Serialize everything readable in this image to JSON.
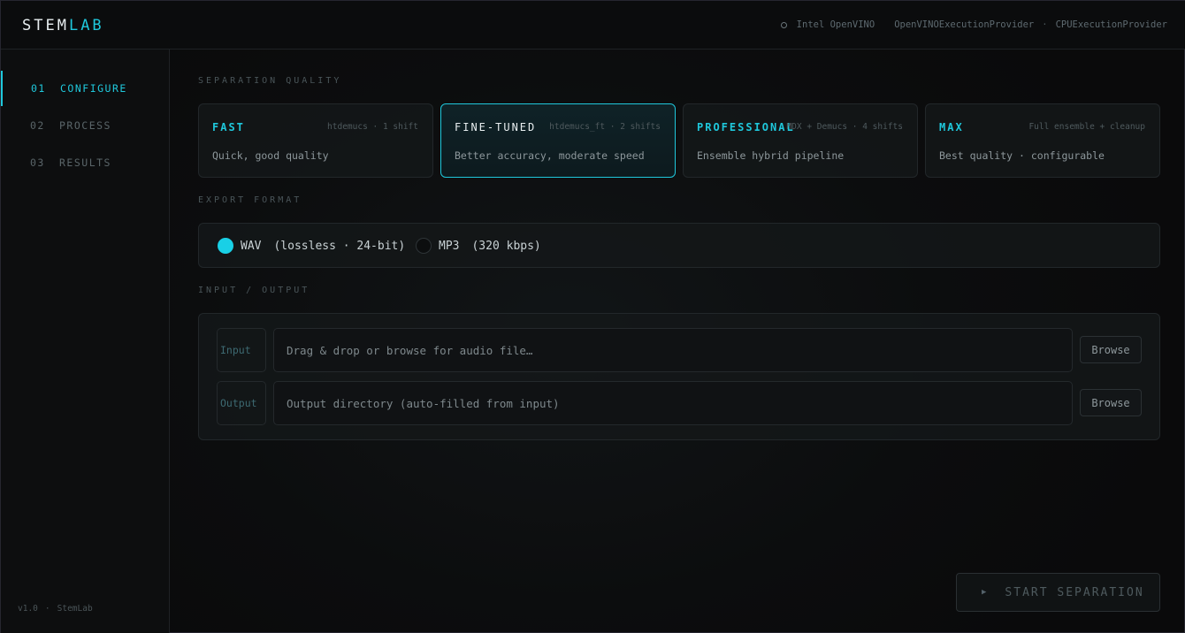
{
  "app": {
    "logo_main": "STEM",
    "logo_accent": "LAB",
    "accent_color": "#1fc8dc"
  },
  "header": {
    "device": "Intel OpenVINO",
    "provider_primary": "OpenVINOExecutionProvider",
    "separator": "·",
    "provider_fallback": "CPUExecutionProvider",
    "status_icon": "circle-outline-icon"
  },
  "sidebar": {
    "items": [
      {
        "num": "01",
        "label": "CONFIGURE",
        "active": true
      },
      {
        "num": "02",
        "label": "PROCESS",
        "active": false
      },
      {
        "num": "03",
        "label": "RESULTS",
        "active": false
      }
    ],
    "footer_version": "v1.0",
    "footer_sep": "·",
    "footer_name": "StemLab"
  },
  "quality": {
    "section_label": "SEPARATION QUALITY",
    "selected": "FINE-TUNED",
    "options": [
      {
        "title": "FAST",
        "meta": "htdemucs · 1 shift",
        "desc": "Quick, good quality"
      },
      {
        "title": "FINE-TUNED",
        "meta": "htdemucs_ft · 2 shifts",
        "desc": "Better accuracy, moderate speed"
      },
      {
        "title": "PROFESSIONAL",
        "meta": "MDX + Demucs · 4 shifts",
        "desc": "Ensemble hybrid pipeline"
      },
      {
        "title": "MAX",
        "meta": "Full ensemble + cleanup",
        "desc": "Best quality · configurable"
      }
    ]
  },
  "export": {
    "section_label": "EXPORT FORMAT",
    "options": [
      {
        "label": "WAV",
        "detail": "(lossless · 24-bit)",
        "checked": true
      },
      {
        "label": "MP3",
        "detail": "(320 kbps)",
        "checked": false
      }
    ]
  },
  "io": {
    "section_label": "INPUT / OUTPUT",
    "input_tag": "Input",
    "input_placeholder": "Drag & drop or browse for audio file…",
    "output_tag": "Output",
    "output_placeholder": "Output directory (auto-filled from input)",
    "browse_label": "Browse"
  },
  "actions": {
    "start_label": "START SEPARATION",
    "start_icon": "play-icon"
  }
}
